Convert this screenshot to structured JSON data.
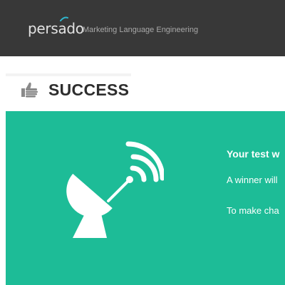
{
  "header": {
    "logo_text": "persado",
    "tagline": "Marketing Language Engineering"
  },
  "status": {
    "title": "SUCCESS",
    "icon": "thumbs-up-icon"
  },
  "panel": {
    "icon": "satellite-dish-icon",
    "heading": "Your test w",
    "line1": "A winner will",
    "line2": "To make cha"
  },
  "colors": {
    "header_bg": "#383838",
    "panel_bg": "#1dbc97",
    "logo_accent": "#2fb8d0"
  }
}
